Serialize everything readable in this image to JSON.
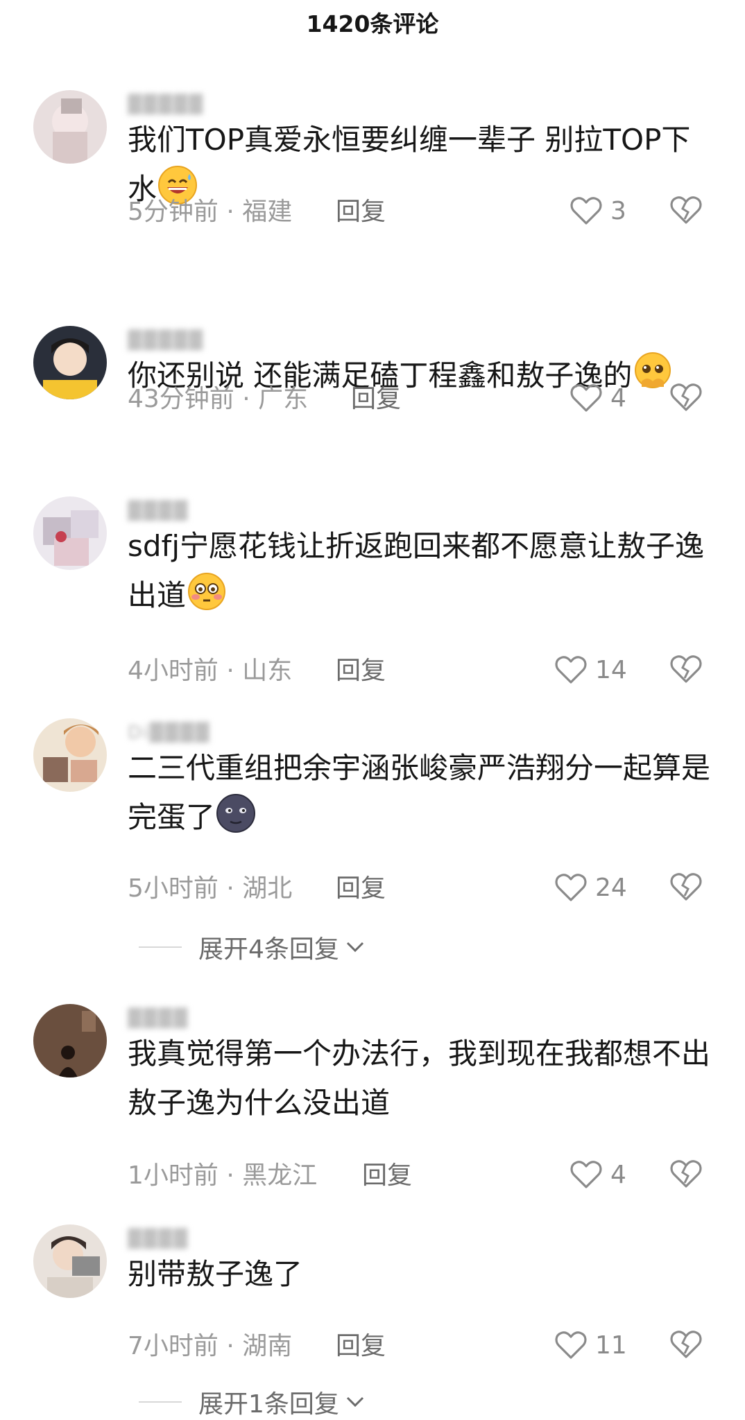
{
  "header": {
    "title": "1420条评论"
  },
  "comments": [
    {
      "username": "▓▓▓▓▓",
      "text_before": "我们TOP真爱永恒要纠缠一辈子 别拉TOP下水",
      "emoji": "grinning-sweat-emoji",
      "time": "5分钟前",
      "location": "福建",
      "reply_label": "回复",
      "likes": "3"
    },
    {
      "username": "▓▓▓▓▓",
      "text_before": "你还别说 还能满足磕丁程鑫和敖子逸的",
      "emoji": "pleading-face-emoji",
      "time": "43分钟前",
      "location": "广东",
      "reply_label": "回复",
      "likes": "4"
    },
    {
      "username": "▓▓▓▓",
      "text_before": "sdfj宁愿花钱让折返跑回来都不愿意让敖子逸出道",
      "emoji": "flushed-face-emoji",
      "time": "4小时前",
      "location": "山东",
      "reply_label": "回复",
      "likes": "14"
    },
    {
      "username": "Di▓▓▓▓",
      "text_before": "二三代重组把余宇涵张峻豪严浩翔分一起算是完蛋了",
      "emoji": "new-moon-face-emoji",
      "time": "5小时前",
      "location": "湖北",
      "reply_label": "回复",
      "likes": "24",
      "expand_label": "展开4条回复"
    },
    {
      "username": "▓▓▓▓",
      "text_before": "我真觉得第一个办法行，我到现在我都想不出敖子逸为什么没出道",
      "emoji": "",
      "time": "1小时前",
      "location": "黑龙江",
      "reply_label": "回复",
      "likes": "4"
    },
    {
      "username": "▓▓▓▓",
      "text_before": "别带敖子逸了",
      "emoji": "",
      "time": "7小时前",
      "location": "湖南",
      "reply_label": "回复",
      "likes": "11",
      "expand_label": "展开1条回复"
    }
  ],
  "colors": {
    "text": "#161616",
    "meta": "#9a9a9a",
    "reply": "#6b6b6b",
    "icon": "#8a8a8a"
  }
}
